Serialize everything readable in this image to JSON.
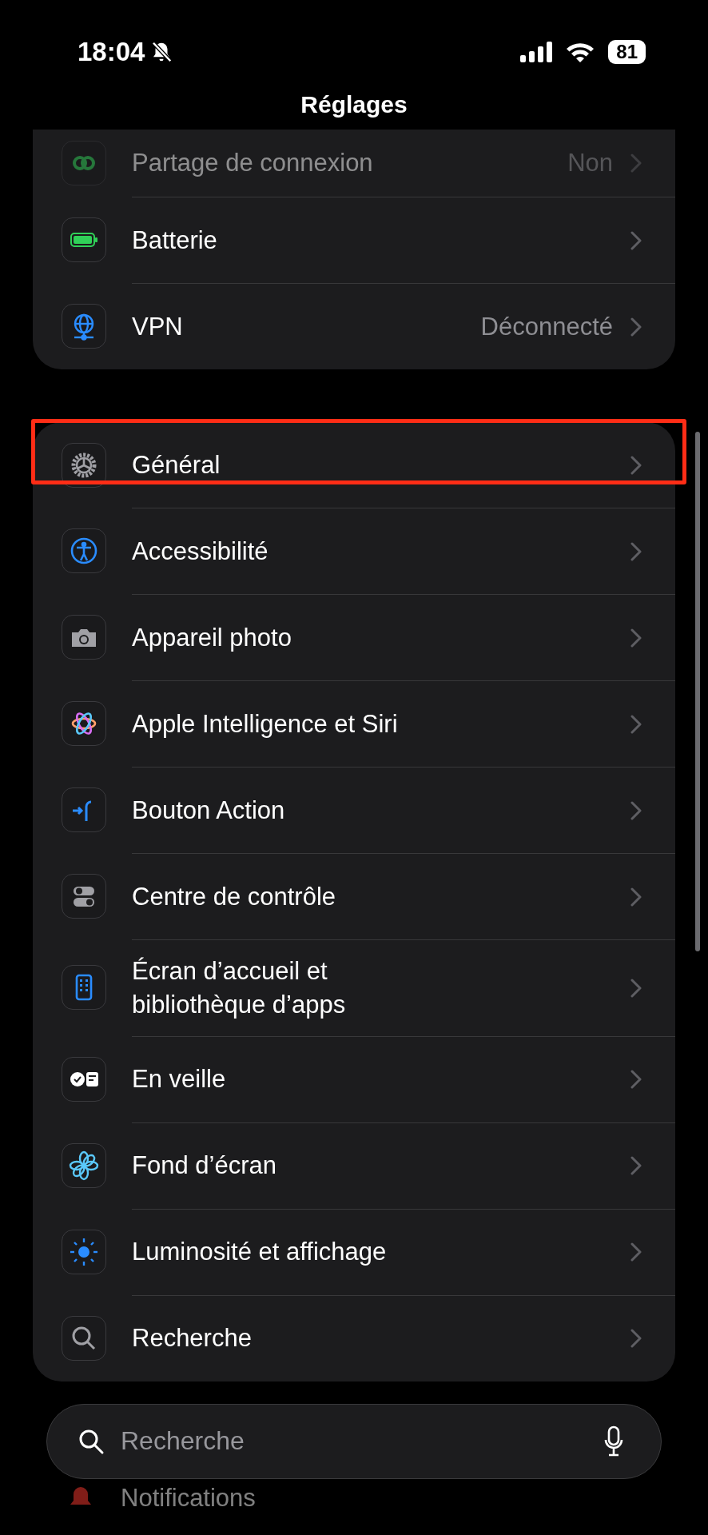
{
  "status_bar": {
    "time": "18:04",
    "silent": true,
    "battery": "81"
  },
  "title": "Réglages",
  "groups": [
    {
      "items": [
        {
          "kind": "hotspot",
          "label": "Partage de connexion",
          "value": "Non",
          "dimmed": true,
          "highlighted": false
        },
        {
          "kind": "battery",
          "label": "Batterie",
          "dimmed": false,
          "highlighted": false
        },
        {
          "kind": "vpn",
          "label": "VPN",
          "value": "Déconnecté",
          "dimmed": false,
          "highlighted": false
        }
      ]
    },
    {
      "items": [
        {
          "kind": "general",
          "label": "Général",
          "dimmed": false,
          "highlighted": true
        },
        {
          "kind": "accessibility",
          "label": "Accessibilité",
          "dimmed": false,
          "highlighted": false
        },
        {
          "kind": "camera",
          "label": "Appareil photo",
          "dimmed": false,
          "highlighted": false
        },
        {
          "kind": "siri",
          "label": "Apple Intelligence et Siri",
          "dimmed": false,
          "highlighted": false
        },
        {
          "kind": "action",
          "label": "Bouton Action",
          "dimmed": false,
          "highlighted": false
        },
        {
          "kind": "control",
          "label": "Centre de contrôle",
          "dimmed": false,
          "highlighted": false
        },
        {
          "kind": "homescreen",
          "label": "Écran d’accueil et\nbibliothèque d’apps",
          "dimmed": false,
          "highlighted": false
        },
        {
          "kind": "standby",
          "label": "En veille",
          "dimmed": false,
          "highlighted": false
        },
        {
          "kind": "wallpaper",
          "label": "Fond d’écran",
          "dimmed": false,
          "highlighted": false
        },
        {
          "kind": "brightness",
          "label": "Luminosité et affichage",
          "dimmed": false,
          "highlighted": false
        },
        {
          "kind": "search",
          "label": "Recherche",
          "dimmed": false,
          "highlighted": false
        }
      ]
    }
  ],
  "search": {
    "placeholder": "Recherche"
  },
  "below": {
    "kind": "notifications",
    "label": "Notifications",
    "dimmed": true
  }
}
